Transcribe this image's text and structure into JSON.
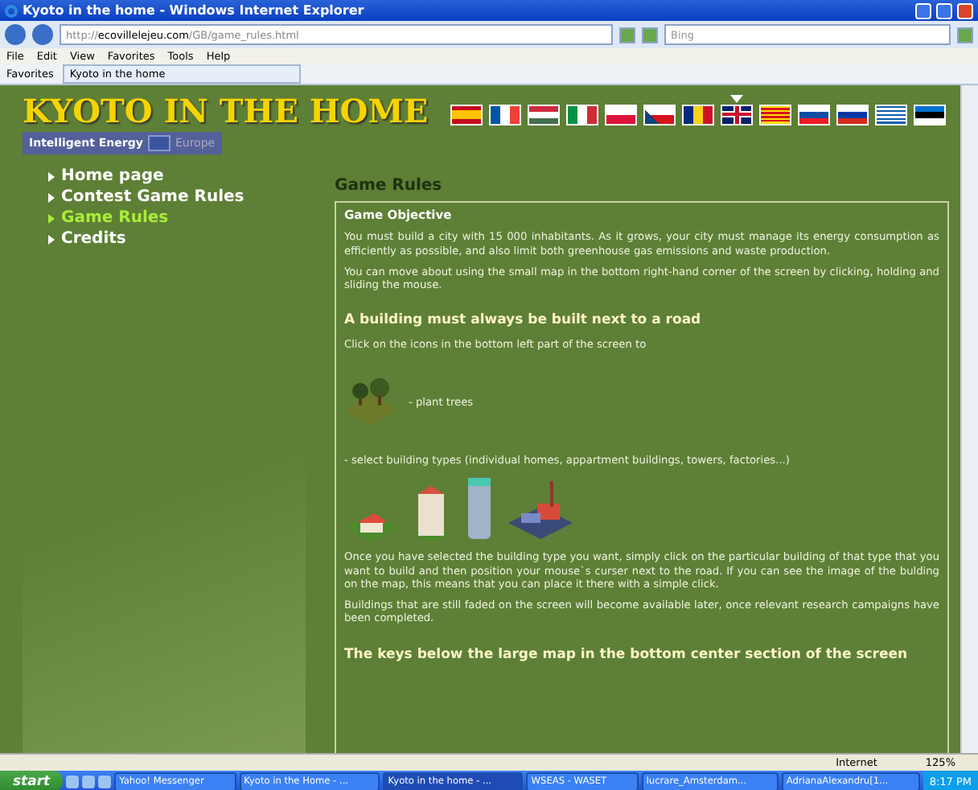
{
  "window": {
    "title": "Kyoto in the home - Windows Internet Explorer"
  },
  "address_bar": {
    "url_prefix": "http://",
    "url_domain": "ecovillelejeu.com",
    "url_path": "/GB/game_rules.html",
    "search_placeholder": "Bing"
  },
  "menu": [
    "File",
    "Edit",
    "View",
    "Favorites",
    "Tools",
    "Help"
  ],
  "favorites_bar": {
    "favorites": "Favorites",
    "tab": "Kyoto in the home"
  },
  "site": {
    "logo": "KYOTO IN THE HOME",
    "sponsor": "Intelligent Energy",
    "sponsor_region": "Europe",
    "flags": [
      {
        "kind": "es",
        "selected": false
      },
      {
        "kind": "fr",
        "selected": false
      },
      {
        "kind": "hu",
        "selected": false
      },
      {
        "kind": "it",
        "selected": false
      },
      {
        "kind": "pl",
        "selected": false
      },
      {
        "kind": "cz",
        "selected": false
      },
      {
        "kind": "ro",
        "selected": false
      },
      {
        "kind": "gb",
        "selected": true
      },
      {
        "kind": "cat",
        "selected": false
      },
      {
        "kind": "sk",
        "selected": false
      },
      {
        "kind": "ru",
        "selected": false
      },
      {
        "kind": "gr",
        "selected": false
      },
      {
        "kind": "ee",
        "selected": false
      }
    ],
    "nav": [
      {
        "label": "Home page",
        "selected": false
      },
      {
        "label": "Contest Game Rules",
        "selected": false
      },
      {
        "label": "Game Rules",
        "selected": true
      },
      {
        "label": "Credits",
        "selected": false
      }
    ]
  },
  "content": {
    "heading": "Game Rules",
    "blocks": [
      {
        "kind": "subheading",
        "text": "Game Objective"
      },
      {
        "kind": "paragraph",
        "text": "You must build a city with 15 000 inhabitants. As it grows, your city must manage its energy consumption as efficiently as possible, and also limit both greenhouse gas emissions and waste production."
      },
      {
        "kind": "paragraph",
        "text": "You can move about using the small map in the bottom right-hand corner of the screen by clicking, holding and sliding the mouse."
      },
      {
        "kind": "heading",
        "text": "A building must always be built next to a road"
      },
      {
        "kind": "paragraph",
        "text": "Click on the icons in the bottom left part of the screen to"
      },
      {
        "kind": "trees",
        "text": "- plant trees"
      },
      {
        "kind": "paragraph",
        "text": "- select building types (individual homes, appartment buildings, towers, factories...)"
      },
      {
        "kind": "buildings"
      },
      {
        "kind": "paragraph",
        "text": "Once you have selected the building type you want, simply click on the particular building of that type that you want to build and then position your mouse`s curser next to the road. If you can see the image of the bulding on the map, this means that you can place it there with a simple click."
      },
      {
        "kind": "paragraph",
        "text": "Buildings that are still faded on the screen will become available later, once relevant research campaigns have been completed."
      },
      {
        "kind": "heading",
        "text": "The keys below the large map in the bottom center section of the screen"
      }
    ]
  },
  "status_bar": {
    "zone": "Internet",
    "zoom": "125%"
  },
  "taskbar": {
    "start": "start",
    "tasks": [
      {
        "label": "Yahoo! Messenger",
        "selected": false
      },
      {
        "label": "Kyoto in the Home - ...",
        "selected": false
      },
      {
        "label": "Kyoto in the home - ...",
        "selected": true
      },
      {
        "label": "WSEAS - WASET",
        "selected": false
      },
      {
        "label": "lucrare_Amsterdam...",
        "selected": false
      },
      {
        "label": "AdrianaAlexandru[1...",
        "selected": false
      }
    ],
    "clock": "8:17 PM"
  }
}
